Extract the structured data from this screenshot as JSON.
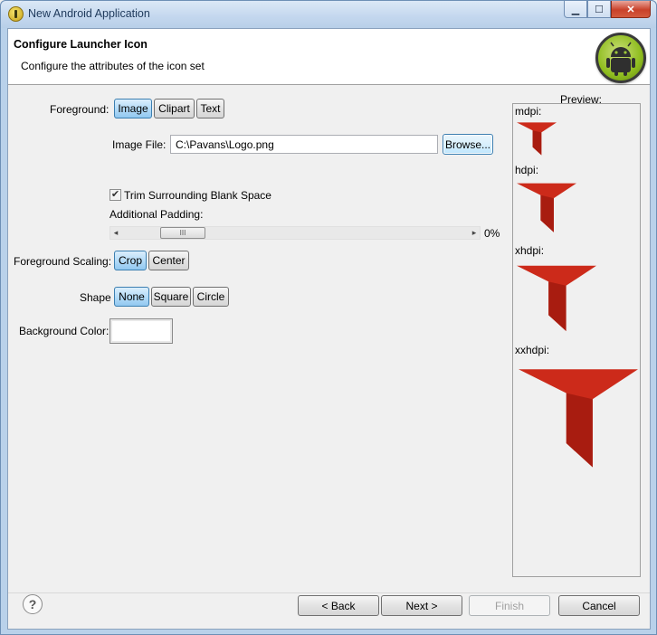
{
  "window": {
    "title": "New Android Application"
  },
  "header": {
    "title": "Configure Launcher Icon",
    "subtitle": "Configure the attributes of the icon set"
  },
  "foreground": {
    "label": "Foreground:",
    "options": [
      "Image",
      "Clipart",
      "Text"
    ],
    "selected": "Image"
  },
  "image_file": {
    "label": "Image File:",
    "value": "C:\\Pavans\\Logo.png",
    "browse_label": "Browse..."
  },
  "trim": {
    "label": "Trim Surrounding Blank Space",
    "checked": true
  },
  "padding": {
    "label": "Additional Padding:",
    "value_text": "0%",
    "value": 0,
    "thumb_glyph": "III"
  },
  "scaling": {
    "label": "Foreground Scaling:",
    "options": [
      "Crop",
      "Center"
    ],
    "selected": "Crop"
  },
  "shape": {
    "label": "Shape",
    "options": [
      "None",
      "Square",
      "Circle"
    ],
    "selected": "None"
  },
  "background_color": {
    "label": "Background Color:",
    "value": "#ffffff"
  },
  "preview": {
    "label": "Preview:",
    "densities": [
      "mdpi:",
      "hdpi:",
      "xhdpi:",
      "xxhdpi:"
    ],
    "icon_color": "#cc2a1a"
  },
  "footer": {
    "help_glyph": "?",
    "back_label": "< Back",
    "next_label": "Next >",
    "finish_label": "Finish",
    "cancel_label": "Cancel"
  }
}
